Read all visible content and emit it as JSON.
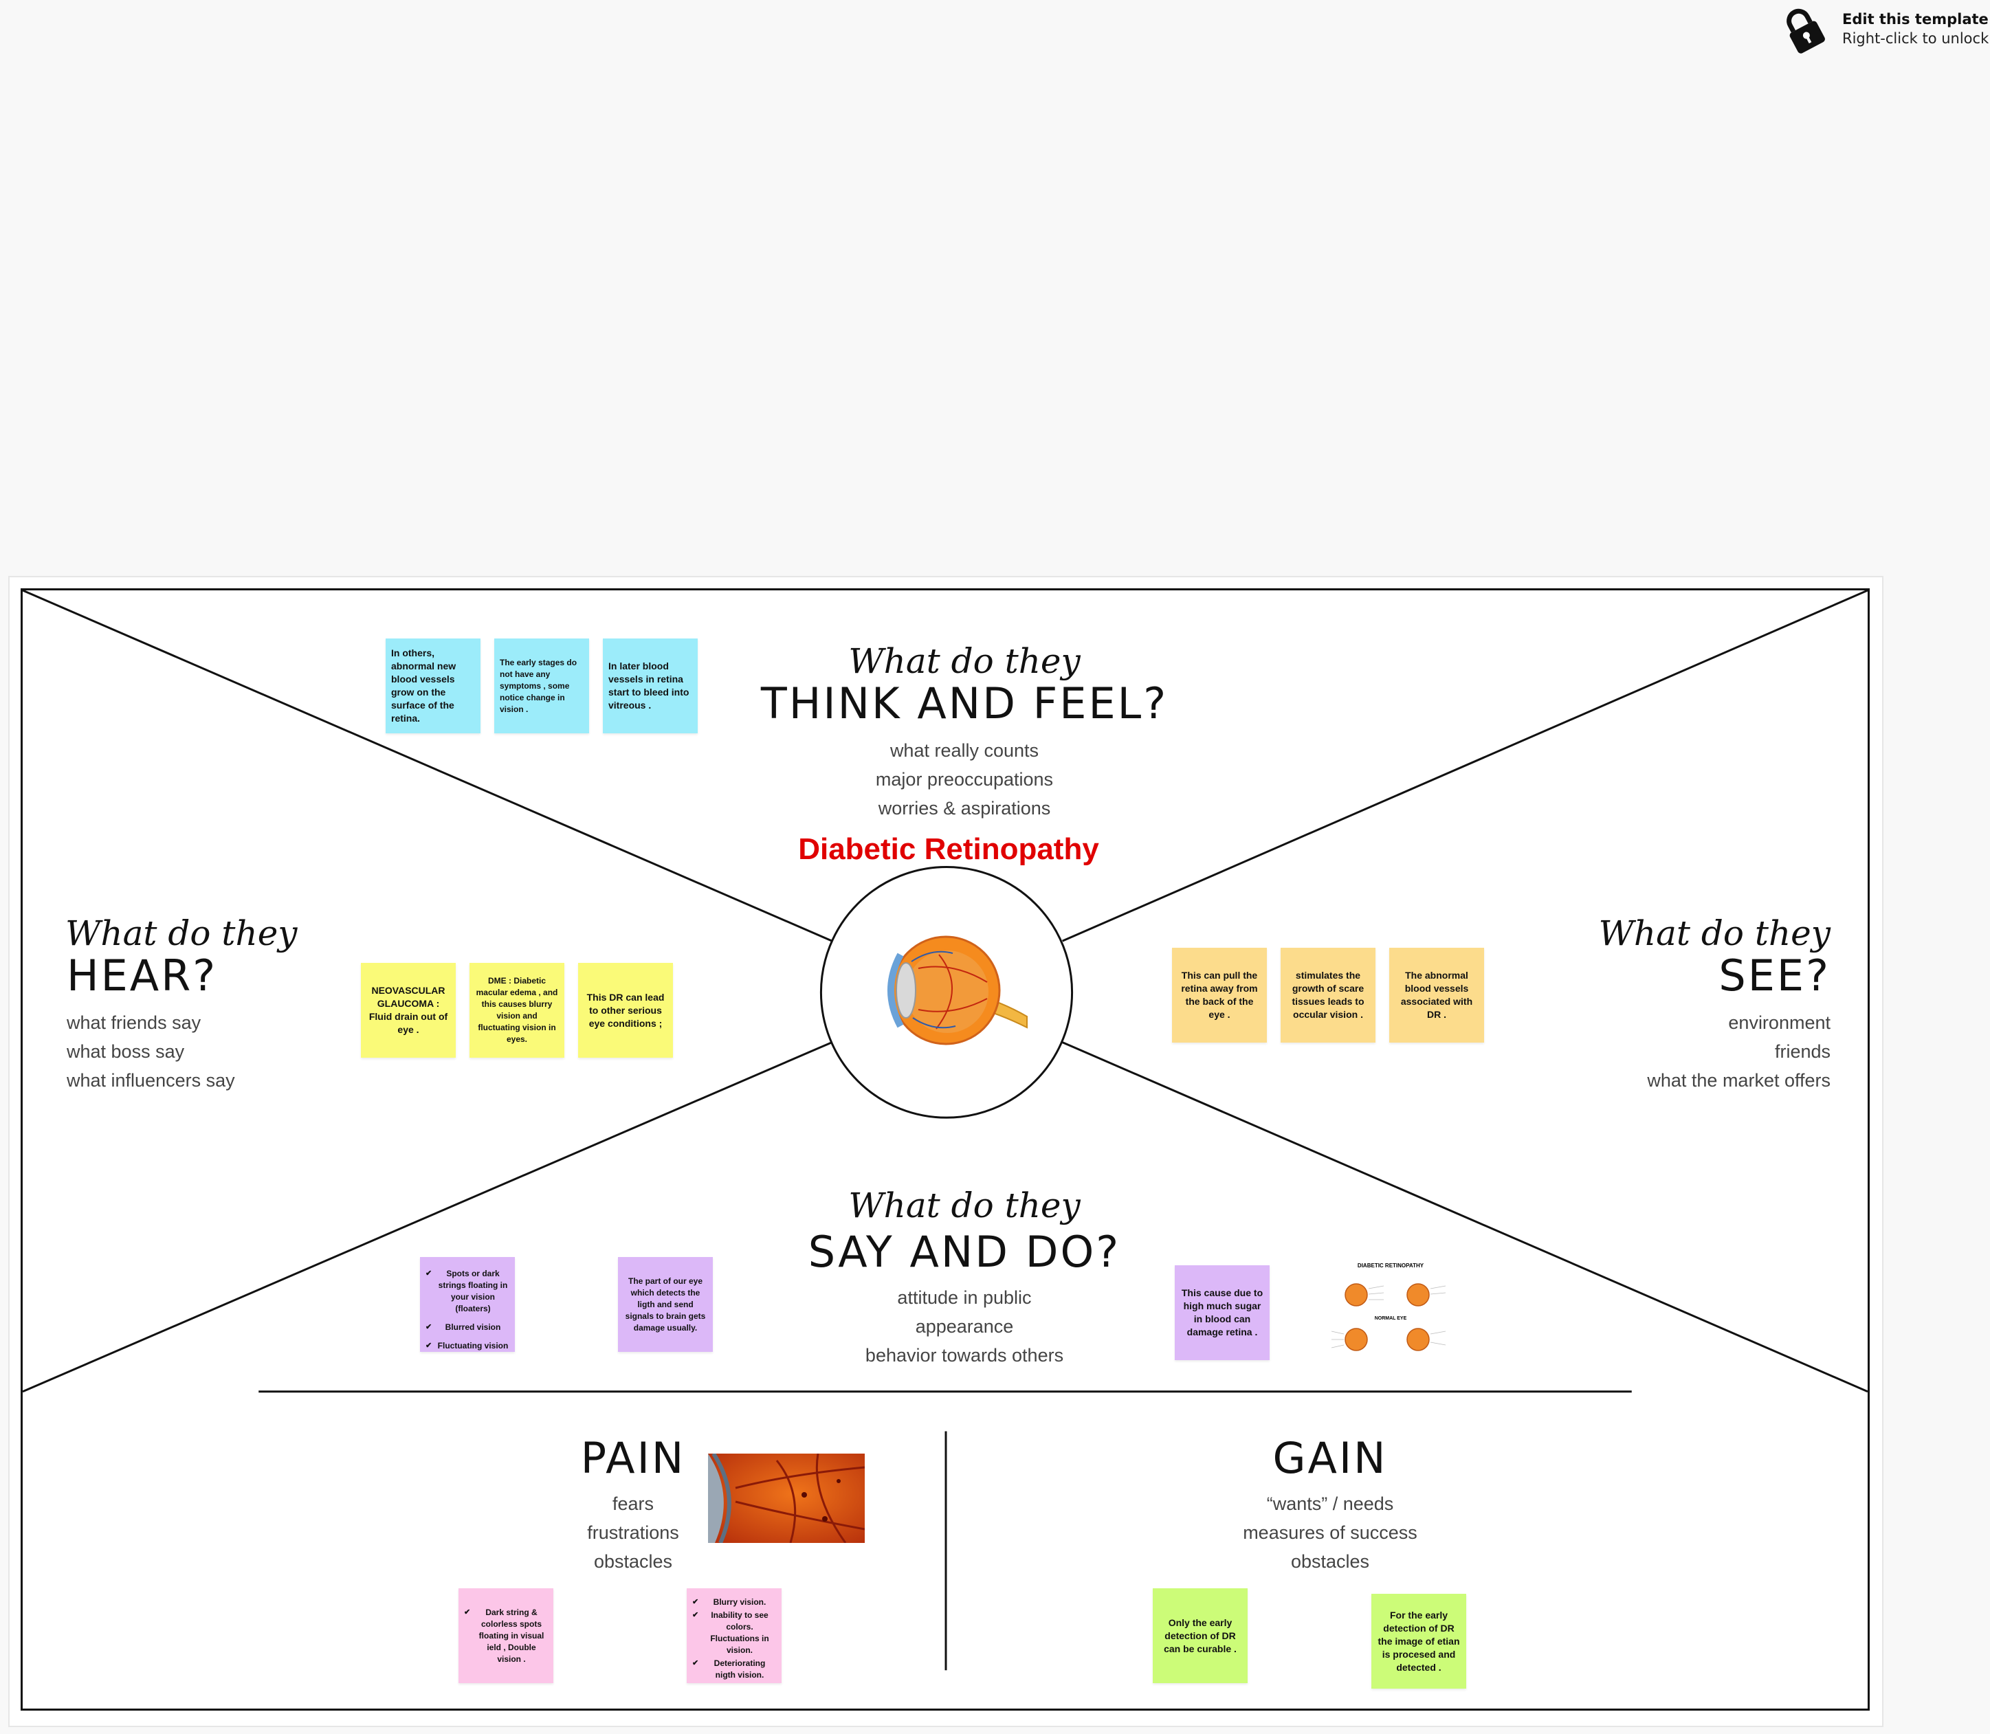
{
  "toolbar_hint": {
    "title": "Edit this template",
    "subtitle": "Right-click to unlock",
    "icon": "lock-icon"
  },
  "center": {
    "title": "Diabetic Retinopathy",
    "image": "eye-anatomy-icon"
  },
  "sections": {
    "think": {
      "script": "What do they",
      "heading": "THINK AND FEEL?",
      "lines": [
        "what really counts",
        "major preoccupations",
        "worries & aspirations"
      ]
    },
    "hear": {
      "script": "What do they",
      "heading": "HEAR?",
      "lines": [
        "what friends say",
        "what boss say",
        "what influencers say"
      ]
    },
    "see": {
      "script": "What do they",
      "heading": "SEE?",
      "lines": [
        "environment",
        "friends",
        "what the market offers"
      ]
    },
    "say": {
      "script": "What do they",
      "heading": "SAY AND DO?",
      "lines": [
        "attitude in public",
        "appearance",
        "behavior towards others"
      ]
    },
    "pain": {
      "heading": "PAIN",
      "lines": [
        "fears",
        "frustrations",
        "obstacles"
      ],
      "image": "retina-closeup-icon"
    },
    "gain": {
      "heading": "GAIN",
      "lines": [
        "“wants” / needs",
        "measures of success",
        "obstacles"
      ]
    }
  },
  "notes": {
    "think": [
      "In others, abnormal new blood vessels grow on the surface of the retina.",
      "The early stages do not have any symptoms , some notice change in vision .",
      "In later blood vessels in retina start to bleed into  vitreous ."
    ],
    "hear": [
      "NEOVASCULAR GLAUCOMA : Fluid drain out of eye .",
      "DME : Diabetic macular edema ,  and  this causes blurry vision and fluctuating vision in eyes.",
      "This DR can lead to other serious eye conditions ;"
    ],
    "see": [
      "This can pull the retina away from the back of the eye .",
      "stimulates the growth of scare tissues leads to occular vision .",
      "The abnormal blood vessels associated with DR ."
    ],
    "say": {
      "symptoms": [
        "Spots or dark strings floating in your vision (floaters)",
        "Blurred vision",
        "Fluctuating vision"
      ],
      "detect": "The part of our eye which detects the ligth and send signals to brain gets damage usually.",
      "cause": "This cause due to high much sugar in blood can damage retina .",
      "diagram": {
        "title": "DIABETIC RETINOPATHY",
        "label": "NORMAL EYE"
      }
    },
    "pain": {
      "a": [
        "Dark string & colorless spots floating in visual ield , Double vision ."
      ],
      "b": [
        "Blurry vision.",
        "Inability to see colors. Fluctuations in vision.",
        "Deteriorating nigth vision."
      ]
    },
    "gain": [
      "Only the early detection of DR can be curable .",
      "For the early detection of DR the image of etian is procesed and detected ."
    ]
  },
  "colors": {
    "cyan": "#9cecfa",
    "yellow": "#fafa78",
    "orange": "#fcdc8c",
    "purple": "#dcb8f8",
    "pink": "#fcc6e8",
    "green": "#ccfc78",
    "title_red": "#e00000"
  }
}
